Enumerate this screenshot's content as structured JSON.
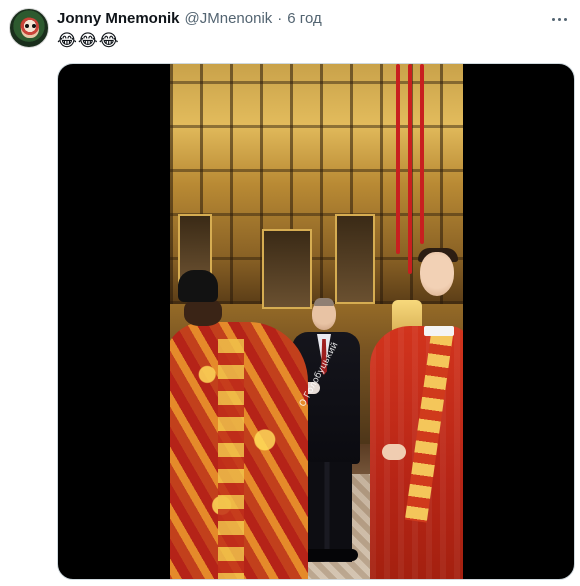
{
  "tweet": {
    "author_name": "Jonny Mnemonik",
    "handle": "@JMnenonik",
    "separator": "·",
    "time": "6 год",
    "text": "😂😂😂"
  },
  "icons": {
    "avatar": "user-avatar",
    "more": "more-options-icon"
  },
  "media": {
    "type": "video",
    "watermark": "О Голобуцький"
  },
  "colors": {
    "name_text": "#0f1419",
    "meta_text": "#536471",
    "media_background": "#000000",
    "media_border": "#cfd9de"
  }
}
